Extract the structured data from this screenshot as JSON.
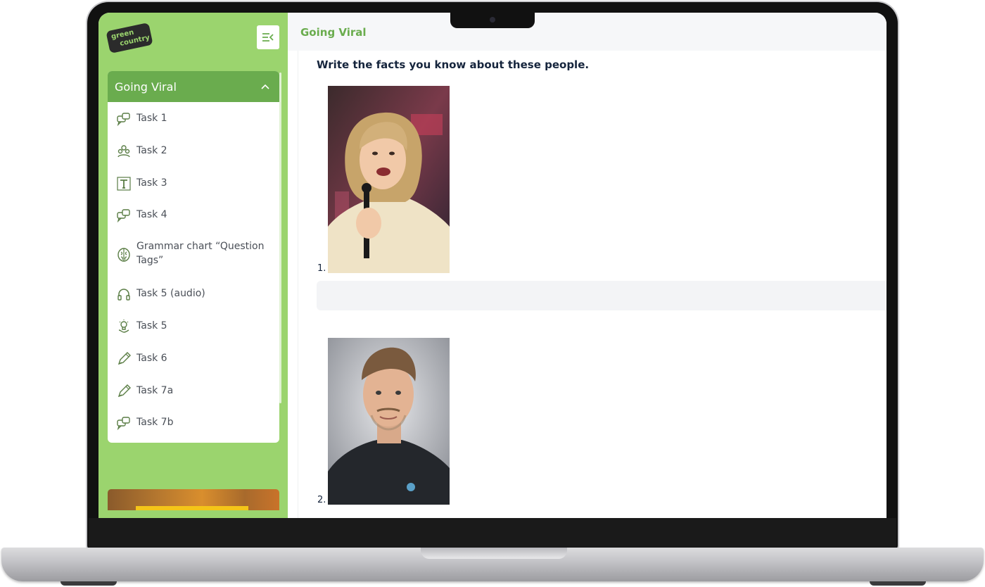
{
  "app": {
    "logo_line1": "green",
    "logo_line2": "country"
  },
  "sidebar": {
    "section_title": "Going Viral",
    "items": [
      {
        "label": "Task 1",
        "icon": "speech-bubbles-icon"
      },
      {
        "label": "Task 2",
        "icon": "people-icon"
      },
      {
        "label": "Task 3",
        "icon": "text-icon"
      },
      {
        "label": "Task 4",
        "icon": "speech-bubbles-icon"
      },
      {
        "label": "Grammar chart “Question Tags”",
        "icon": "brain-icon"
      },
      {
        "label": "Task 5 (audio)",
        "icon": "headphones-icon"
      },
      {
        "label": "Task 5",
        "icon": "lightbulb-hand-icon"
      },
      {
        "label": "Task 6",
        "icon": "pencil-icon"
      },
      {
        "label": "Task 7a",
        "icon": "pencil-icon"
      },
      {
        "label": "Task 7b",
        "icon": "speech-bubbles-icon"
      }
    ]
  },
  "header": {
    "title": "Going Viral"
  },
  "main": {
    "prompt": "Write the facts you know about these people.",
    "questions": [
      {
        "number": "1.",
        "image": "woman-with-microphone-photo",
        "answer": ""
      },
      {
        "number": "2.",
        "image": "man-portrait-photo",
        "answer": ""
      }
    ]
  },
  "colors": {
    "sidebar_bg": "#9bd46e",
    "accent": "#6aac4e",
    "text_dark": "#16253d"
  }
}
